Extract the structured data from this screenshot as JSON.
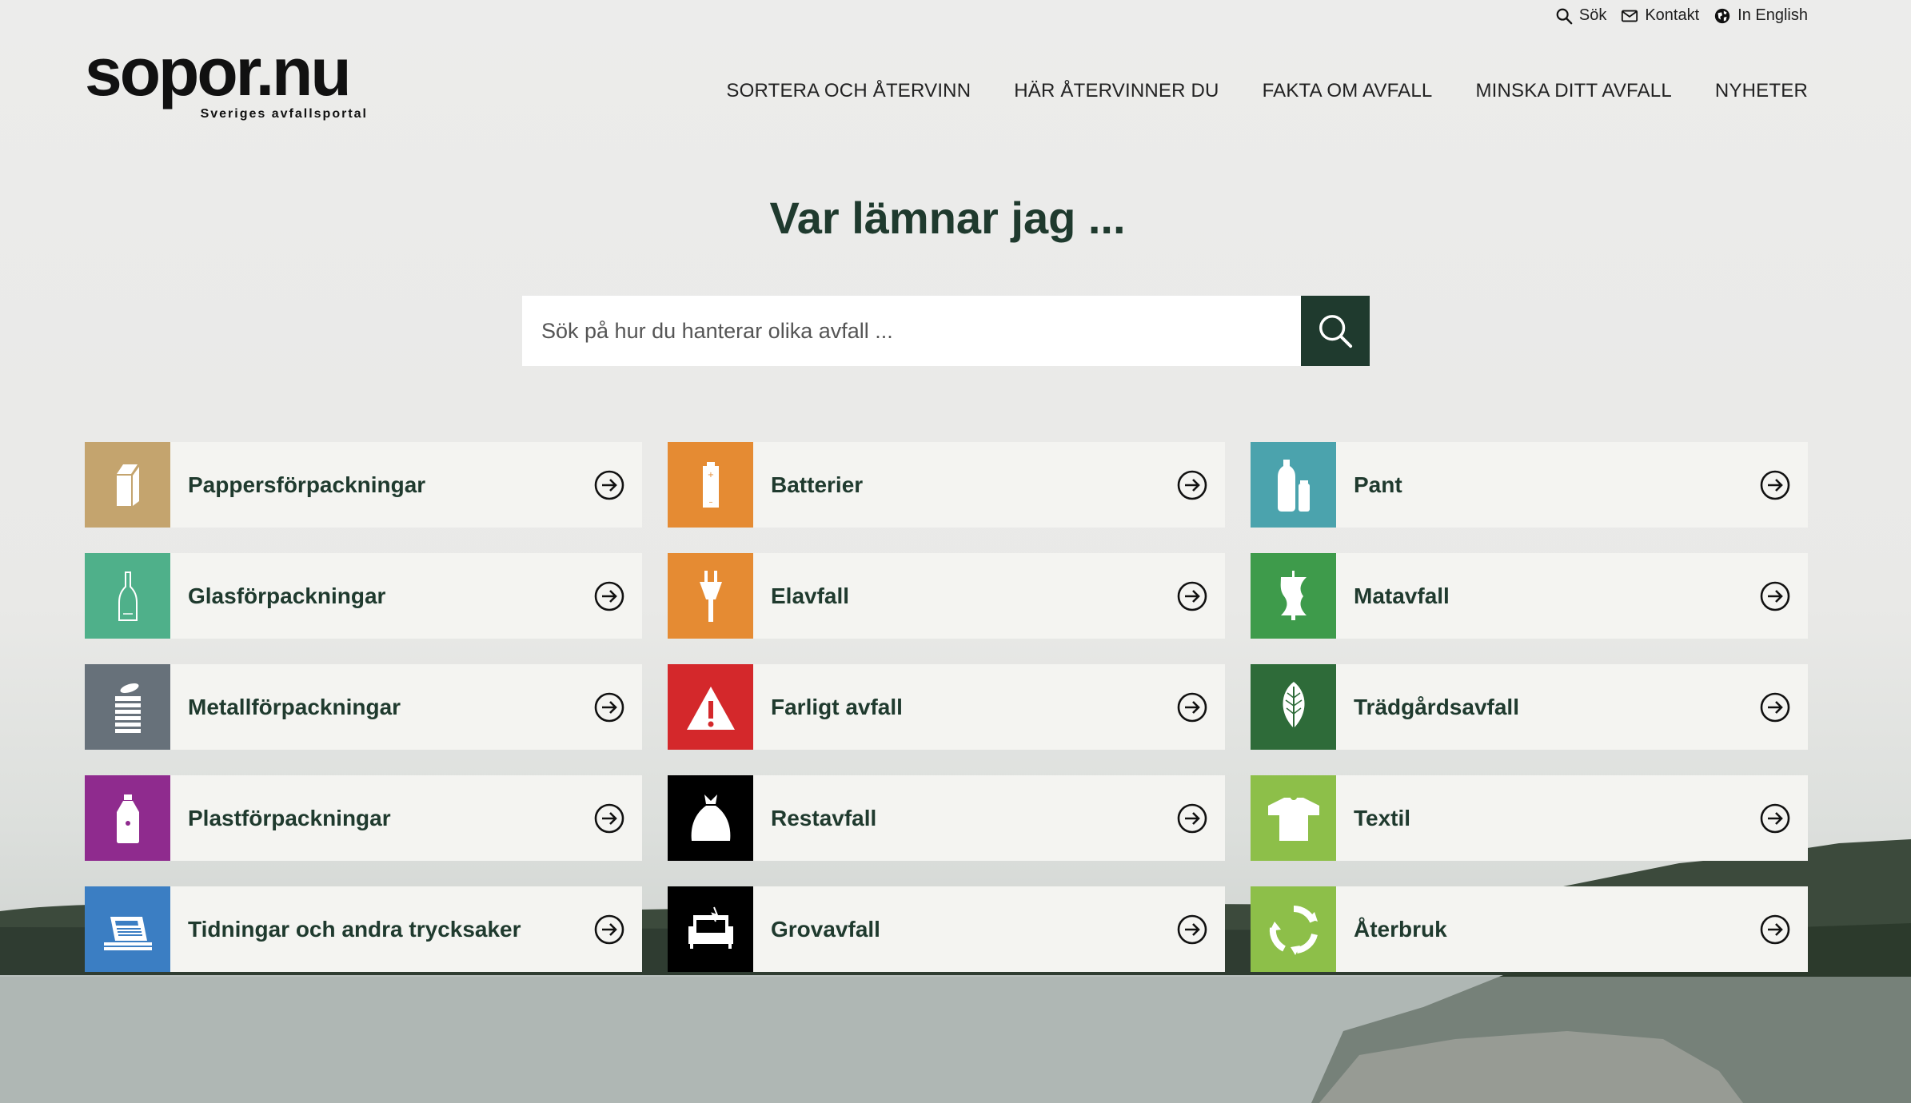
{
  "util_nav": [
    {
      "label": "Sök",
      "icon": "search-icon"
    },
    {
      "label": "Kontakt",
      "icon": "mail-icon"
    },
    {
      "label": "In English",
      "icon": "globe-icon"
    }
  ],
  "logo": {
    "name": "sopor.nu",
    "tagline": "Sveriges avfallsportal"
  },
  "main_nav": [
    "SORTERA OCH ÅTERVINN",
    "HÄR ÅTERVINNER DU",
    "FAKTA OM AVFALL",
    "MINSKA DITT AVFALL",
    "NYHETER"
  ],
  "hero": {
    "title": "Var lämnar jag ..."
  },
  "search": {
    "placeholder": "Sök på hur du hanterar olika avfall ..."
  },
  "categories": [
    {
      "label": "Pappersförpackningar",
      "color": "#c4a46e",
      "icon": "milk-carton-icon"
    },
    {
      "label": "Batterier",
      "color": "#e58b33",
      "icon": "battery-icon"
    },
    {
      "label": "Pant",
      "color": "#4ba3ad",
      "icon": "bottles-icon"
    },
    {
      "label": "Glasförpackningar",
      "color": "#4fb08a",
      "icon": "glass-bottle-icon"
    },
    {
      "label": "Elavfall",
      "color": "#e58b33",
      "icon": "plug-icon"
    },
    {
      "label": "Matavfall",
      "color": "#3e9b4b",
      "icon": "apple-core-icon"
    },
    {
      "label": "Metallförpackningar",
      "color": "#67717a",
      "icon": "can-icon"
    },
    {
      "label": "Farligt avfall",
      "color": "#d4282b",
      "icon": "warning-icon"
    },
    {
      "label": "Trädgårdsavfall",
      "color": "#2e6b39",
      "icon": "leaf-icon"
    },
    {
      "label": "Plastförpackningar",
      "color": "#8f2b8e",
      "icon": "plastic-bottle-icon"
    },
    {
      "label": "Restavfall",
      "color": "#000000",
      "icon": "garbage-bag-icon"
    },
    {
      "label": "Textil",
      "color": "#8dbf49",
      "icon": "tshirt-icon"
    },
    {
      "label": "Tidningar och andra trycksaker",
      "color": "#3b7ec3",
      "icon": "newspaper-icon"
    },
    {
      "label": "Grovavfall",
      "color": "#000000",
      "icon": "sofa-icon"
    },
    {
      "label": "Återbruk",
      "color": "#8dbf49",
      "icon": "recycle-icon"
    }
  ]
}
